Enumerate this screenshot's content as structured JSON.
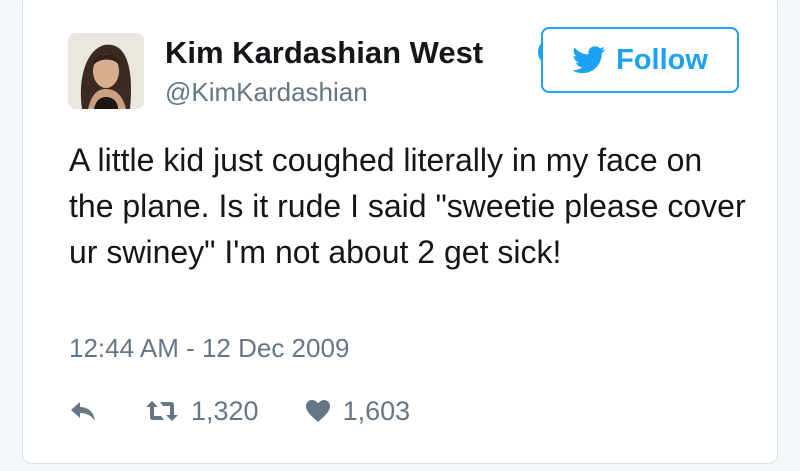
{
  "tweet": {
    "author_name": "Kim Kardashian West",
    "author_handle": "@KimKardashian",
    "follow_label": "Follow",
    "text": "A little kid just coughed literally in my face on the plane. Is it rude I said \"sweetie please cover ur swiney\" I'm not about 2 get sick!",
    "timestamp": "12:44 AM - 12 Dec 2009",
    "retweets": "1,320",
    "likes": "1,603"
  },
  "colors": {
    "accent": "#1da1f2",
    "text_primary": "#14171a",
    "text_secondary": "#657786"
  },
  "icons": [
    "verified-badge-icon",
    "twitter-bird-icon",
    "reply-icon",
    "retweet-icon",
    "heart-icon"
  ]
}
